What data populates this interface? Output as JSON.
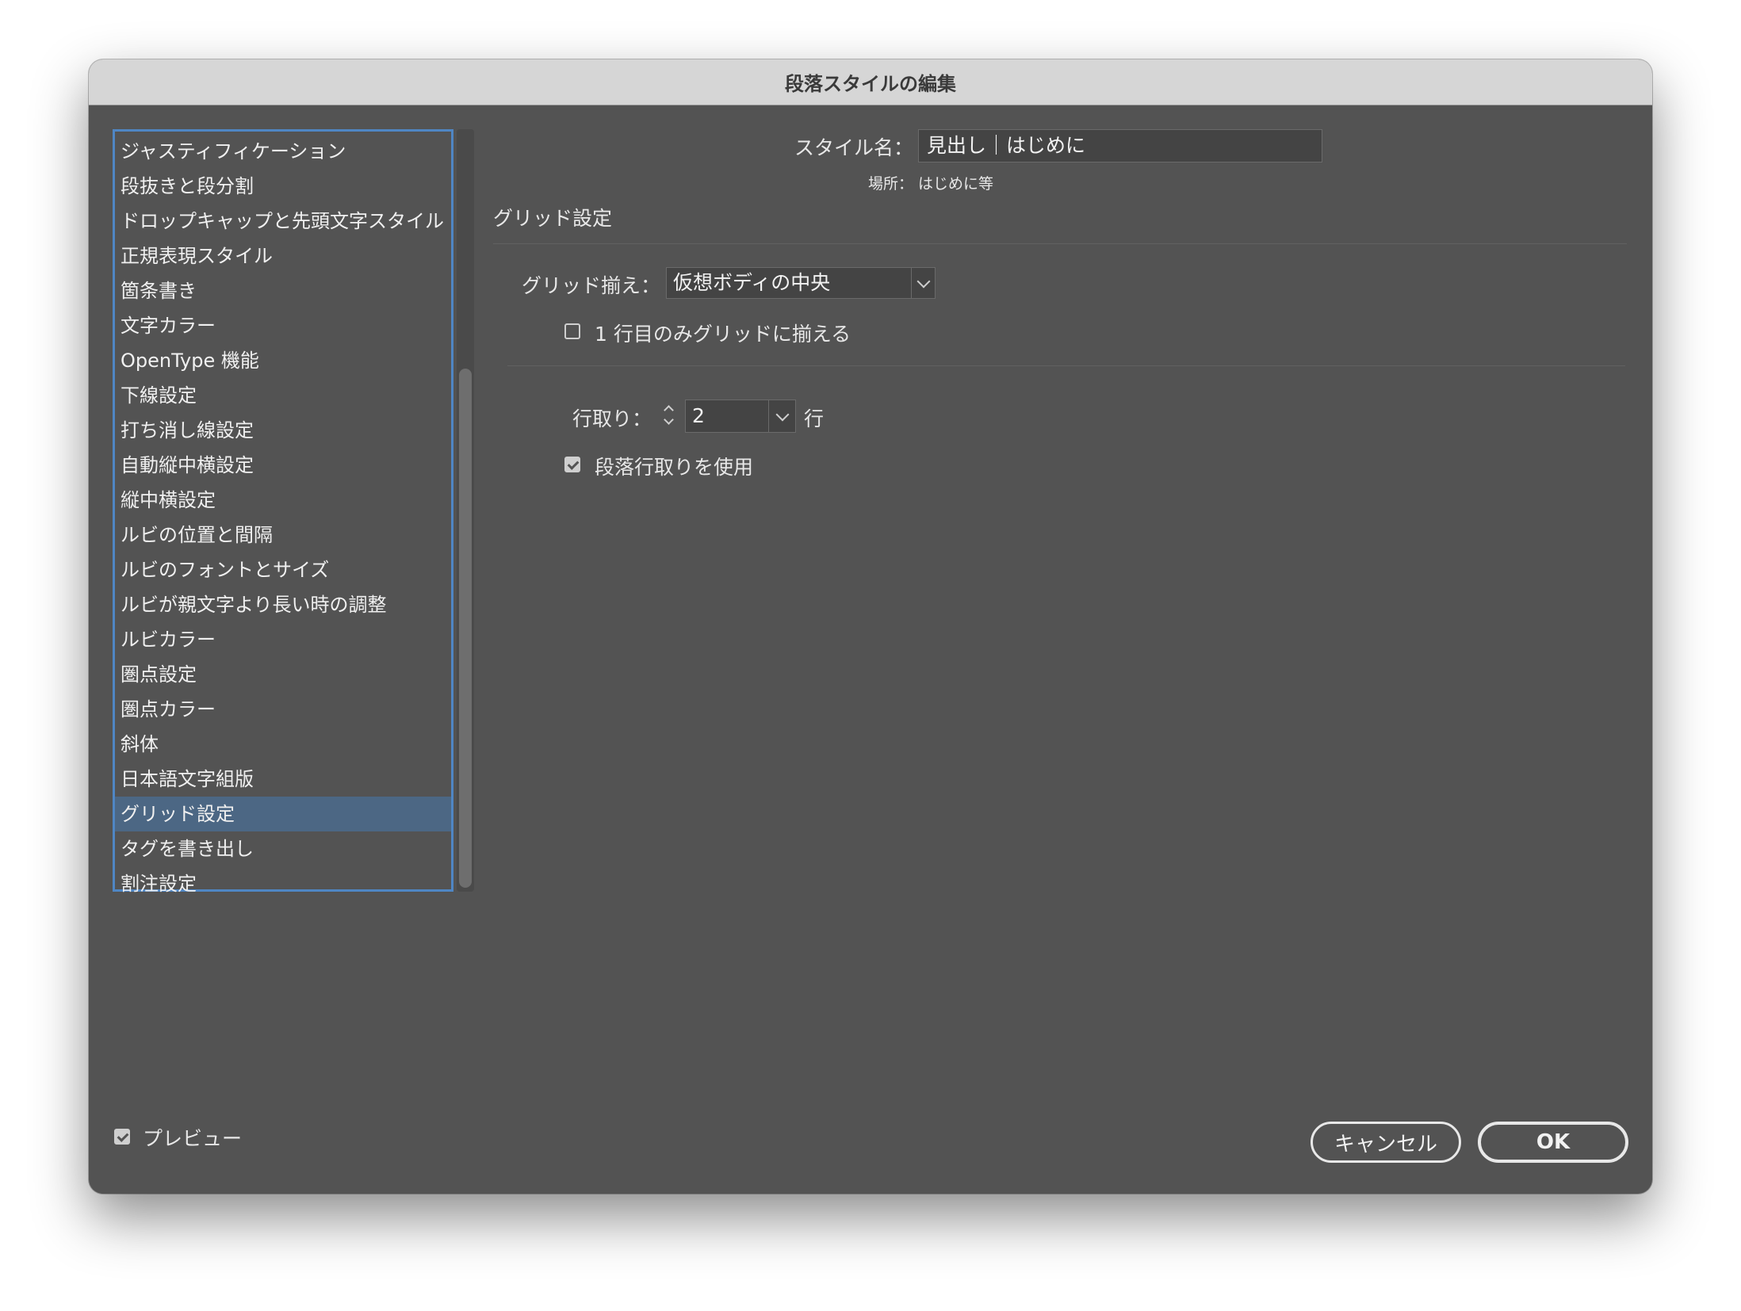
{
  "dialog": {
    "title": "段落スタイルの編集"
  },
  "sidebar": {
    "items": [
      {
        "label": "ジャスティフィケーション"
      },
      {
        "label": "段抜きと段分割"
      },
      {
        "label": "ドロップキャップと先頭文字スタイル"
      },
      {
        "label": "正規表現スタイル"
      },
      {
        "label": "箇条書き"
      },
      {
        "label": "文字カラー"
      },
      {
        "label": "OpenType 機能"
      },
      {
        "label": "下線設定"
      },
      {
        "label": "打ち消し線設定"
      },
      {
        "label": "自動縦中横設定"
      },
      {
        "label": "縦中横設定"
      },
      {
        "label": "ルビの位置と間隔"
      },
      {
        "label": "ルビのフォントとサイズ"
      },
      {
        "label": "ルビが親文字より長い時の調整"
      },
      {
        "label": "ルビカラー"
      },
      {
        "label": "圏点設定"
      },
      {
        "label": "圏点カラー"
      },
      {
        "label": "斜体"
      },
      {
        "label": "日本語文字組版"
      },
      {
        "label": "グリッド設定"
      },
      {
        "label": "タグを書き出し"
      },
      {
        "label": "割注設定"
      }
    ],
    "selected_index": 19
  },
  "header": {
    "style_name_label": "スタイル名：",
    "style_name_value": "見出し｜はじめに",
    "location_label": "場所：",
    "location_value": "はじめに等"
  },
  "section": {
    "title": "グリッド設定"
  },
  "grid": {
    "align_label": "グリッド揃え：",
    "align_value": "仮想ボディの中央",
    "first_line_only_label": "1 行目のみグリッドに揃える",
    "first_line_only_checked": false,
    "line_span_label": "行取り：",
    "line_span_value": "2",
    "line_span_unit": "行",
    "use_paragraph_span_label": "段落行取りを使用",
    "use_paragraph_span_checked": true
  },
  "footer": {
    "preview_label": "プレビュー",
    "preview_checked": true,
    "cancel_label": "キャンセル",
    "ok_label": "OK"
  },
  "colors": {
    "dialog_bg": "#535353",
    "titlebar_bg": "#d6d6d6",
    "list_border": "#4f86c4",
    "selection_bg": "#4c6784"
  }
}
